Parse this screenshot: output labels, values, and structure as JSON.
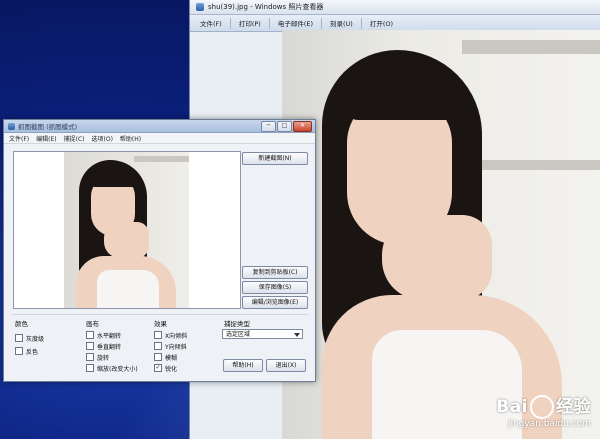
{
  "viewer": {
    "title": "shu(39).jpg - Windows 照片查看器",
    "menu": [
      "文件(F)",
      "打印(P)",
      "电子邮件(E)",
      "刻录(U)",
      "打开(O)"
    ]
  },
  "watermark": {
    "brand_left": "Bai",
    "brand_right": "经验",
    "url": "jingyan.baidu.com"
  },
  "dialog": {
    "title": "抓图截图 (抓图模式)",
    "controls": [
      "─",
      "□",
      "✕"
    ],
    "menu": [
      "文件(F)",
      "编辑(E)",
      "捕捉(C)",
      "选项(O)",
      "帮助(H)"
    ],
    "buttons": {
      "new_capture": "新建截图(N)",
      "copy_clipboard": "复制到剪贴板(C)",
      "save_image": "保存图像(S)",
      "edit_browse": "编辑/浏览图像(E)",
      "help": "帮助(H)",
      "exit": "退出(X)"
    },
    "color_group": {
      "title": "颜色",
      "options": [
        {
          "label": "灰度级",
          "checked": false
        },
        {
          "label": "反色",
          "checked": false
        }
      ]
    },
    "canvas_group": {
      "title": "画布",
      "options": [
        {
          "label": "水平翻转",
          "checked": false
        },
        {
          "label": "垂直翻转",
          "checked": false
        },
        {
          "label": "旋转",
          "checked": false
        },
        {
          "label": "缩放(改变大小)",
          "checked": false
        }
      ]
    },
    "effects_group": {
      "title": "效果",
      "options": [
        {
          "label": "X向倾斜",
          "checked": false
        },
        {
          "label": "Y向倾斜",
          "checked": false
        },
        {
          "label": "模糊",
          "checked": false
        },
        {
          "label": "锐化",
          "checked": true
        }
      ]
    },
    "capture_type": {
      "title": "捕捉类型",
      "selected": "选定区域"
    }
  },
  "icons": {
    "viewer_app": "photo-viewer-icon",
    "dialog_app": "capture-app-icon"
  }
}
